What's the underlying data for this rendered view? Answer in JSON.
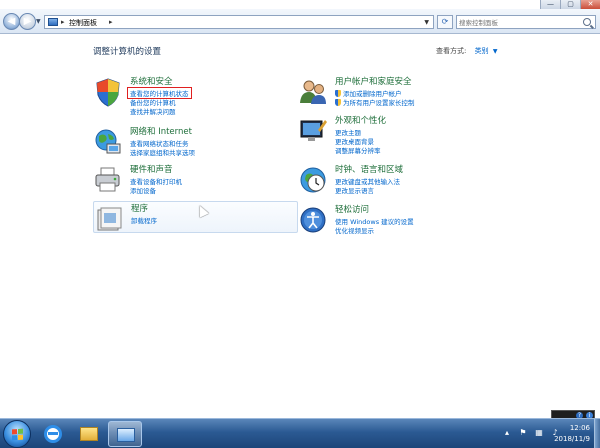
{
  "window": {
    "controls": {
      "minimize": "—",
      "maximize": "▢",
      "close": "✕"
    }
  },
  "address": {
    "back_glyph": "◀",
    "forward_glyph": "▶",
    "breadcrumb": "控制面板",
    "separator": "▸",
    "refresh_glyph": "⟳",
    "search_placeholder": "搜索控制面板"
  },
  "main": {
    "title": "调整计算机的设置",
    "view_by_label": "查看方式:",
    "view_by_value": "类别"
  },
  "categories": [
    {
      "title": "系统和安全",
      "links": [
        "查看您的计算机状态",
        "备份您的计算机",
        "查找并解决问题"
      ]
    },
    {
      "title": "网络和 Internet",
      "links": [
        "查看网络状态和任务",
        "选择家庭组和共享选项"
      ]
    },
    {
      "title": "硬件和声音",
      "links": [
        "查看设备和打印机",
        "添加设备"
      ]
    },
    {
      "title": "程序",
      "links": [
        "卸载程序"
      ]
    },
    {
      "title": "用户帐户和家庭安全",
      "links": [
        "添加或删除用户帐户",
        "为所有用户设置家长控制"
      ]
    },
    {
      "title": "外观和个性化",
      "links": [
        "更改主题",
        "更改桌面背景",
        "调整屏幕分辨率"
      ]
    },
    {
      "title": "时钟、语言和区域",
      "links": [
        "更改键盘或其他输入法",
        "更改显示语言"
      ]
    },
    {
      "title": "轻松访问",
      "links": [
        "使用 Windows 建议的设置",
        "优化视频显示"
      ]
    }
  ],
  "taskbar": {
    "time": "12:06",
    "date": "2018/11/9"
  },
  "colors": {
    "link": "#0066cc",
    "category_title": "#1e6e3a",
    "highlight_box": "#e02020",
    "taskbar": "#2b5a93"
  }
}
